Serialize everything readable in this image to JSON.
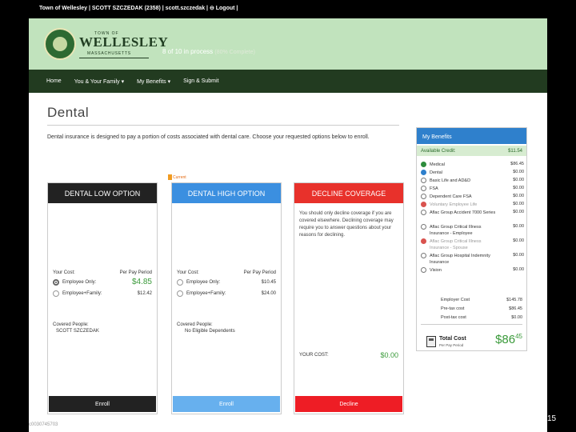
{
  "topbar": {
    "text": "Town of Wellesley | SCOTT SZCZEDAK (2358) | scott.szczedak | ⊖ Logout |"
  },
  "header": {
    "logo_town": "TOWN OF",
    "logo_name": "WELLESLEY",
    "logo_state": "MASSACHUSETTS",
    "progress": "8 of 10 in process",
    "progress_pct": "(80% Complete)"
  },
  "nav": {
    "items": [
      "Home",
      "You & Your Family ▾",
      "My Benefits ▾",
      "Sign & Submit"
    ]
  },
  "page": {
    "title": "Dental",
    "intro": "Dental insurance is designed to pay a portion of costs associated with dental care. Choose your requested options below to enroll."
  },
  "cards": {
    "low": {
      "title": "DENTAL LOW OPTION",
      "cost_label": "Your Cost:",
      "per_pay": "Per Pay Period",
      "opt1_label": "Employee Only:",
      "opt1_price": "$4.85",
      "opt2_label": "Employee+Family:",
      "opt2_price": "$12.42",
      "covered_label": "Covered People:",
      "covered_value": "SCOTT SZCZEDAK",
      "button": "Enroll"
    },
    "high": {
      "badge": "Current",
      "title": "DENTAL HIGH OPTION",
      "cost_label": "Your Cost:",
      "per_pay": "Per Pay Period",
      "opt1_label": "Employee Only:",
      "opt1_price": "$10.45",
      "opt2_label": "Employee+Family:",
      "opt2_price": "$24.00",
      "covered_label": "Covered People:",
      "covered_value": "No Eligible Dependents",
      "button": "Enroll"
    },
    "decline": {
      "title": "DECLINE COVERAGE",
      "text": "You should only decline coverage if you are covered elsewhere. Declining coverage may require you to answer questions about your reasons for declining.",
      "cost_label": "YOUR COST:",
      "cost_value": "$0.00",
      "button": "Decline"
    }
  },
  "benefits": {
    "title": "My Benefits",
    "available_label": "Available Credit:",
    "available_value": "$11.54",
    "items": [
      {
        "label": "Medical",
        "amount": "$86.45",
        "status": "green"
      },
      {
        "label": "Dental",
        "amount": "$0.00",
        "status": "blue"
      },
      {
        "label": "Basic Life and AD&D",
        "amount": "$0.00",
        "status": "none"
      },
      {
        "label": "FSA",
        "amount": "$0.00",
        "status": "none"
      },
      {
        "label": "Dependent Care FSA",
        "amount": "$0.00",
        "status": "none"
      },
      {
        "label": "Voluntary Employee Life",
        "amount": "$0.00",
        "status": "red"
      },
      {
        "label": "Aflac Group Accident 7000 Series",
        "amount": "$0.00",
        "status": "none"
      },
      {
        "label": "Aflac Group Critical Illness Insurance - Employee",
        "amount": "$0.00",
        "status": "none"
      },
      {
        "label": "Aflac Group Critical Illness Insurance - Spouse",
        "amount": "$0.00",
        "status": "red"
      },
      {
        "label": "Aflac Group Hospital Indemnity Insurance",
        "amount": "$0.00",
        "status": "none"
      },
      {
        "label": "Vision",
        "amount": "$0.00",
        "status": "none"
      }
    ],
    "employer_label": "Employer Cost",
    "employer_value": "$145.78",
    "pretax_label": "Pre-tax cost",
    "pretax_value": "$86.45",
    "posttax_label": "Post-tax cost",
    "posttax_value": "$0.00",
    "total_label": "Total Cost",
    "total_sub": "Per Pay Period",
    "total_dollars": "$86",
    "total_cents": "45"
  },
  "footer": {
    "id": "c0030745703",
    "slide": "15"
  }
}
